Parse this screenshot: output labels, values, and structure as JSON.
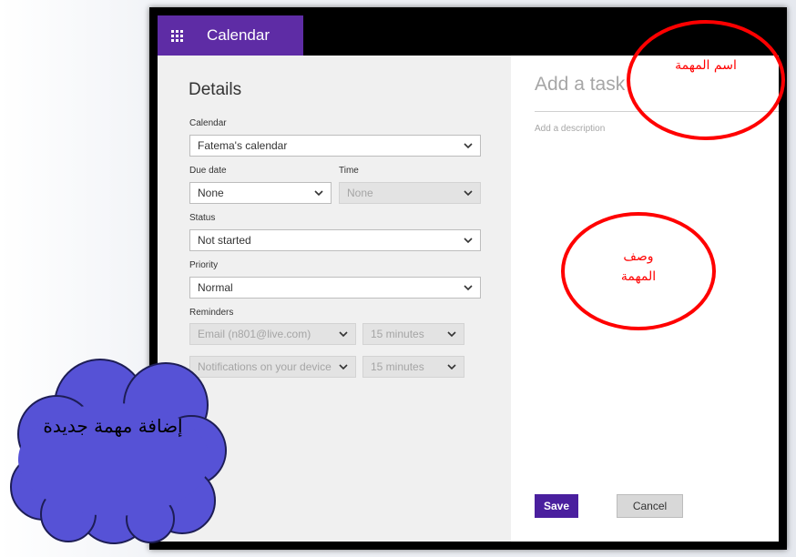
{
  "app": {
    "name": "Calendar",
    "launcher_icon": "app-launcher-grid-icon",
    "accent": "#5e2ca5"
  },
  "details": {
    "title": "Details",
    "calendar": {
      "label": "Calendar",
      "value": "Fatema's calendar"
    },
    "due_date": {
      "label": "Due date",
      "value": "None"
    },
    "time": {
      "label": "Time",
      "value": "None"
    },
    "status": {
      "label": "Status",
      "value": "Not started"
    },
    "priority": {
      "label": "Priority",
      "value": "Normal"
    },
    "reminders": {
      "label": "Reminders",
      "email": {
        "value": "Email (n801@live.com)",
        "interval": "15 minutes"
      },
      "notifications": {
        "value": "Notifications on your device",
        "interval": "15 minutes"
      }
    }
  },
  "task": {
    "title_placeholder": "Add a task",
    "description_placeholder": "Add a description"
  },
  "buttons": {
    "save": "Save",
    "cancel": "Cancel",
    "save_color": "#4a1f9e"
  },
  "annotations": {
    "task_name": "اسم المهمة",
    "task_description": "وصف المهمة",
    "add_task_cloud": "إضافة مهمة جديدة",
    "circle_color": "#ff0000",
    "cloud_color": "#5652d6"
  }
}
